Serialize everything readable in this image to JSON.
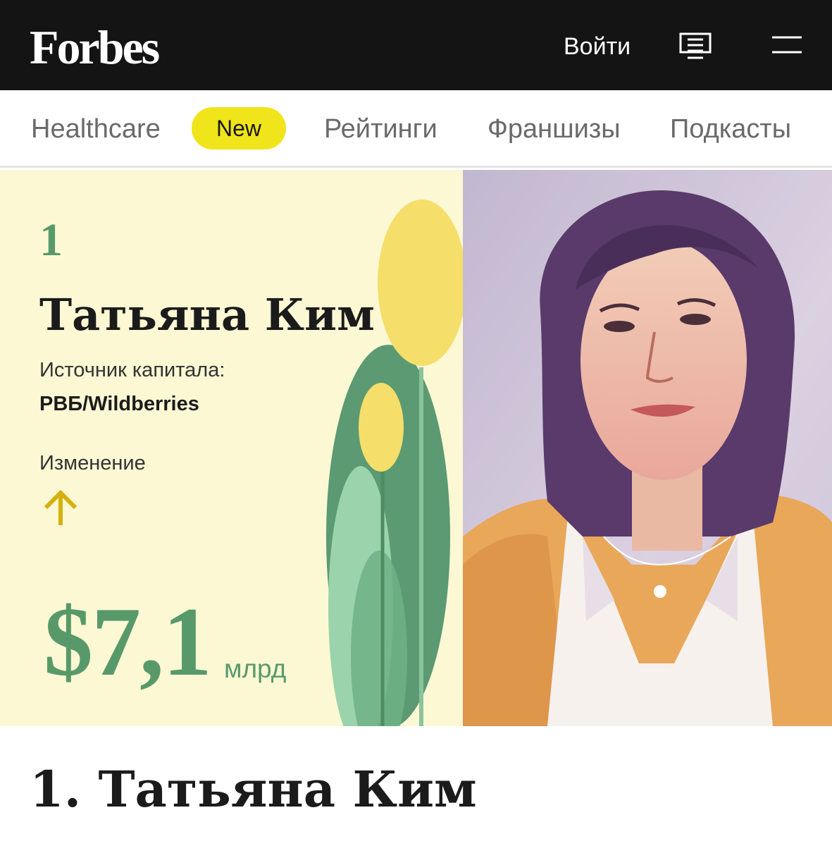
{
  "header": {
    "logo": "Forbes",
    "login_label": "Войти",
    "icons": [
      "issues-icon",
      "menu-icon"
    ]
  },
  "nav": {
    "items": [
      {
        "label": "Healthcare"
      },
      {
        "label": "Рейтинги"
      },
      {
        "label": "Франшизы"
      },
      {
        "label": "Подкасты"
      }
    ],
    "badge": "New"
  },
  "hero": {
    "rank": "1",
    "name": "Татьяна Ким",
    "capital_source_label": "Источник капитала:",
    "capital_source_value": "РВБ/Wildberries",
    "change_label": "Изменение",
    "change_direction": "arrow-up-icon",
    "net_worth": "$7,1",
    "net_worth_unit": "млрд"
  },
  "article": {
    "title": "1. Татьяна Ким"
  },
  "colors": {
    "header_bg": "#141414",
    "badge": "#f0e41a",
    "hero_bg": "#fdf8d4",
    "accent_green": "#58996a",
    "arrow_yellow": "#d4b10c"
  }
}
